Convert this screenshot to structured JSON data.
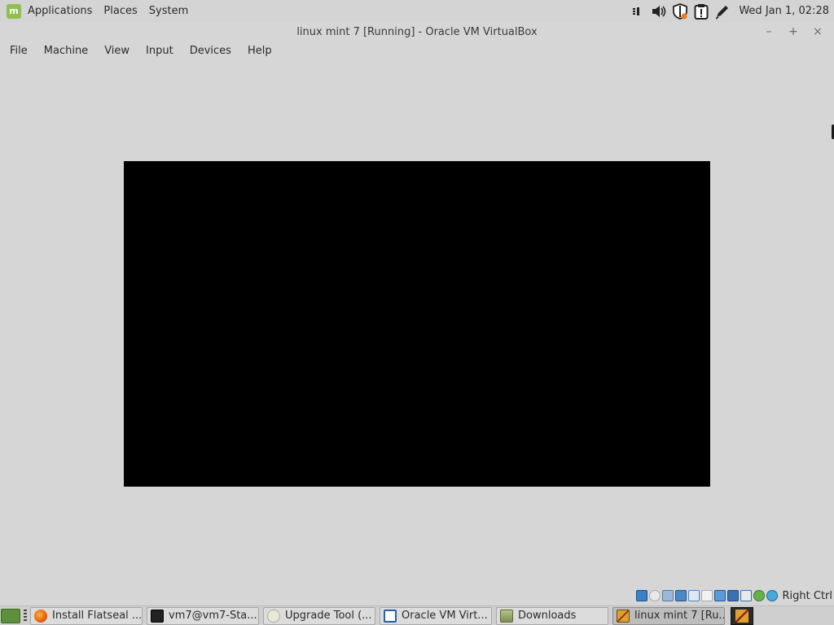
{
  "top_panel": {
    "menu": [
      "Applications",
      "Places",
      "System"
    ],
    "clock": "Wed Jan  1, 02:28",
    "tray_icons": [
      "network-bars-icon",
      "volume-icon",
      "shield-update-icon",
      "clipboard-notice-icon",
      "pen-icon"
    ]
  },
  "window": {
    "title": "linux mint 7 [Running] - Oracle VM VirtualBox",
    "controls": {
      "minimize": "–",
      "maximize": "+",
      "close": "×"
    }
  },
  "menubar": [
    "File",
    "Machine",
    "View",
    "Input",
    "Devices",
    "Help"
  ],
  "status_bar": {
    "host_key": "Right Ctrl",
    "icons": [
      "hard-disk-icon",
      "optical-disk-icon",
      "audio-icon",
      "network-icon",
      "usb-icon",
      "shared-folders-icon",
      "display-icon",
      "video-capture-icon",
      "virtualization-icon",
      "mouse-integration-icon",
      "keyboard-icon"
    ]
  },
  "taskbar": {
    "tasks": [
      {
        "label": "Install Flatseal ...",
        "icon": "firefox-icon",
        "color": "#e66000"
      },
      {
        "label": "vm7@vm7-Sta...",
        "icon": "terminal-icon",
        "color": "#222222"
      },
      {
        "label": "Upgrade Tool (...",
        "icon": "upgrade-tool-icon",
        "color": "#e8e8d8"
      },
      {
        "label": "Oracle VM Virt...",
        "icon": "virtualbox-icon",
        "color": "#2a5db0"
      },
      {
        "label": "Downloads",
        "icon": "folder-icon",
        "color": "#8a9a5b"
      },
      {
        "label": "linux mint 7 [Ru...",
        "icon": "virtualbox-vm-icon",
        "color": "#e0a030",
        "active": true
      }
    ]
  },
  "colors": {
    "background": "#d6d6d6",
    "vm_screen": "#000000",
    "mint_green": "#8fbf4f"
  }
}
